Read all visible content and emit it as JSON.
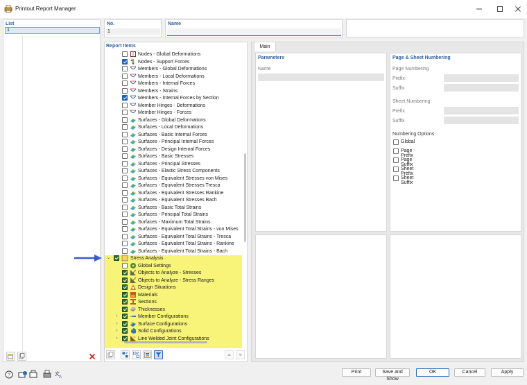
{
  "window": {
    "title": "Printout Report Manager",
    "minimize_icon": "minimize-icon",
    "maximize_icon": "maximize-icon",
    "close_icon": "close-icon"
  },
  "list": {
    "header": "List",
    "items": [
      "1"
    ]
  },
  "no": {
    "header": "No.",
    "value": "1"
  },
  "name": {
    "header": "Name",
    "value": ""
  },
  "report_items": {
    "header": "Report Items",
    "rows": [
      {
        "label": "Nodes - Global Deformations",
        "checked": false,
        "icon": "nodes-deformation-icon"
      },
      {
        "label": "Nodes - Support Forces",
        "checked": true,
        "icon": "support-forces-icon"
      },
      {
        "label": "Members - Global Deformations",
        "checked": false,
        "icon": "member-deformation-icon"
      },
      {
        "label": "Members - Local Deformations",
        "checked": false,
        "icon": "member-deformation-icon"
      },
      {
        "label": "Members - Internal Forces",
        "checked": false,
        "icon": "member-deformation-icon"
      },
      {
        "label": "Members - Strains",
        "checked": false,
        "icon": "member-deformation-icon"
      },
      {
        "label": "Members - Internal Forces by Section",
        "checked": true,
        "icon": "member-deformation-icon"
      },
      {
        "label": "Member Hinges - Deformations",
        "checked": false,
        "icon": "member-deformation-icon"
      },
      {
        "label": "Member Hinges - Forces",
        "checked": false,
        "icon": "member-deformation-icon"
      },
      {
        "label": "Surfaces - Global Deformations",
        "checked": false,
        "icon": "surface-result-icon"
      },
      {
        "label": "Surfaces - Local Deformations",
        "checked": false,
        "icon": "surface-result-icon"
      },
      {
        "label": "Surfaces - Basic Internal Forces",
        "checked": false,
        "icon": "surface-result-icon"
      },
      {
        "label": "Surfaces - Principal Internal Forces",
        "checked": false,
        "icon": "surface-result-icon"
      },
      {
        "label": "Surfaces - Design Internal Forces",
        "checked": false,
        "icon": "surface-result-icon"
      },
      {
        "label": "Surfaces - Basic Stresses",
        "checked": false,
        "icon": "surface-result-icon"
      },
      {
        "label": "Surfaces - Principal Stresses",
        "checked": false,
        "icon": "surface-result-icon"
      },
      {
        "label": "Surfaces - Elastic Stress Components",
        "checked": false,
        "icon": "surface-result-icon"
      },
      {
        "label": "Surfaces - Equivalent Stresses von Mises",
        "checked": false,
        "icon": "surface-result-icon"
      },
      {
        "label": "Surfaces - Equivalent Stresses Tresca",
        "checked": false,
        "icon": "surface-result-icon"
      },
      {
        "label": "Surfaces - Equivalent Stresses Rankine",
        "checked": false,
        "icon": "surface-result-icon"
      },
      {
        "label": "Surfaces - Equivalent Stresses Bach",
        "checked": false,
        "icon": "surface-result-icon"
      },
      {
        "label": "Surfaces - Basic Total Strains",
        "checked": false,
        "icon": "surface-result-icon"
      },
      {
        "label": "Surfaces - Principal Total Strains",
        "checked": false,
        "icon": "surface-result-icon"
      },
      {
        "label": "Surfaces - Maximum Total Strains",
        "checked": false,
        "icon": "surface-result-icon"
      },
      {
        "label": "Surfaces - Equivalent Total Strains - von Mises",
        "checked": false,
        "icon": "surface-result-icon"
      },
      {
        "label": "Surfaces - Equivalent Total Strains - Tresca",
        "checked": false,
        "icon": "surface-result-icon"
      },
      {
        "label": "Surfaces - Equivalent Total Strains - Rankine",
        "checked": false,
        "icon": "surface-result-icon"
      },
      {
        "label": "Surfaces - Equivalent Total Strains - Bach",
        "checked": false,
        "icon": "surface-result-icon"
      },
      {
        "label": "Stress Analysis",
        "checked": true,
        "icon": "stress-analysis-icon",
        "level": 0,
        "expanded": true
      },
      {
        "label": "Global Settings",
        "checked": false,
        "icon": "global-settings-icon",
        "level": 1
      },
      {
        "label": "Objects to Analyze - Stresses",
        "checked": true,
        "icon": "objects-analyze-icon",
        "level": 1
      },
      {
        "label": "Objects to Analyze - Stress Ranges",
        "checked": true,
        "icon": "objects-analyze-icon",
        "level": 1
      },
      {
        "label": "Design Situations",
        "checked": true,
        "icon": "design-situations-icon",
        "level": 1
      },
      {
        "label": "Materials",
        "checked": true,
        "icon": "materials-icon",
        "level": 1
      },
      {
        "label": "Sections",
        "checked": true,
        "icon": "sections-icon",
        "level": 1
      },
      {
        "label": "Thicknesses",
        "checked": true,
        "icon": "thicknesses-icon",
        "level": 1
      },
      {
        "label": "Member Configurations",
        "checked": true,
        "icon": "member-config-icon",
        "level": 1,
        "collapsed": true
      },
      {
        "label": "Surface Configurations",
        "checked": true,
        "icon": "surface-config-icon",
        "level": 1,
        "collapsed": true
      },
      {
        "label": "Solid Configurations",
        "checked": true,
        "icon": "solid-config-icon",
        "level": 1,
        "collapsed": true
      },
      {
        "label": "Line Welded Joint Configurations",
        "checked": true,
        "icon": "weld-config-icon",
        "level": 1,
        "collapsed": true
      }
    ]
  },
  "main_tab": {
    "label": "Main"
  },
  "parameters": {
    "header": "Parameters",
    "name_label": "Name",
    "name_value": ""
  },
  "page_numbering": {
    "header": "Page & Sheet Numbering",
    "page_numbering_label": "Page Numbering",
    "prefix_label": "Prefix",
    "suffix_label": "Suffix",
    "sheet_numbering_label": "Sheet Numbering",
    "sheet_prefix_label": "Prefix",
    "sheet_suffix_label": "Suffix",
    "options_header": "Numbering Options",
    "options": [
      "Global",
      "Page Prefix",
      "Page Suffix",
      "Sheet Prefix",
      "Sheet Suffix"
    ]
  },
  "footer": {
    "print": "Print",
    "save_and_show": "Save and Show",
    "ok": "OK",
    "cancel": "Cancel",
    "apply": "Apply"
  }
}
